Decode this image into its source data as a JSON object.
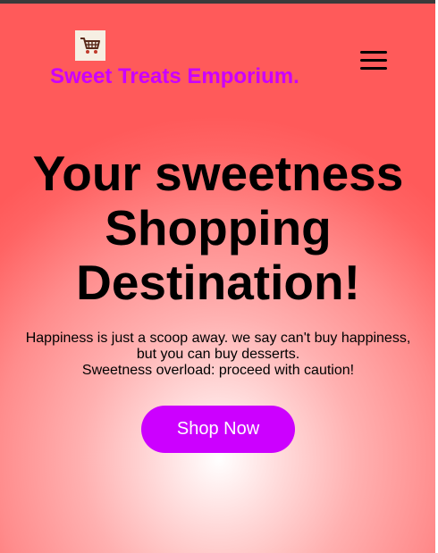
{
  "header": {
    "logo_icon": "shopping-cart-icon",
    "brand_name": "Sweet Treats Emporium.",
    "menu_icon": "hamburger-menu-icon"
  },
  "hero": {
    "title_lines": [
      "Your sweetness",
      "Shopping",
      "Destination!"
    ],
    "text_lines": [
      "Happiness is just a scoop away. we say can't buy happiness,",
      "but you can buy desserts.",
      "Sweetness overload: proceed with caution!"
    ],
    "cta_label": "Shop Now"
  },
  "colors": {
    "brand": "#cc00ff",
    "button_text": "#ffffff",
    "background_edge": "#ff5a5a",
    "background_center": "#ffffff"
  }
}
